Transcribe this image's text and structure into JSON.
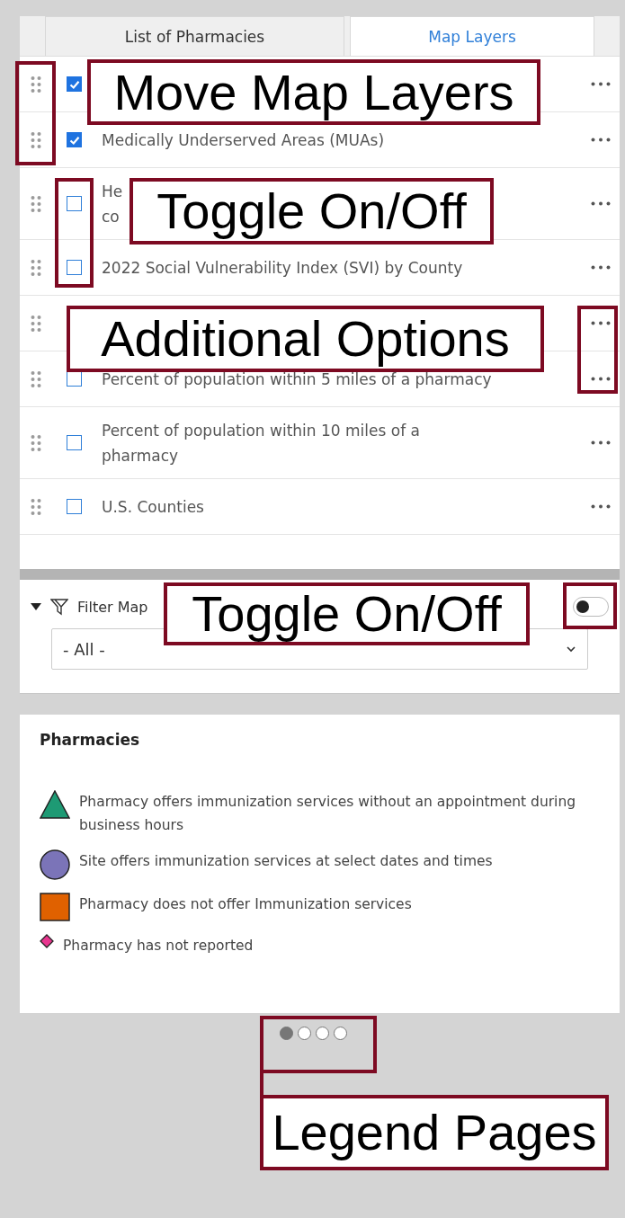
{
  "tabs": [
    {
      "label": "List of Pharmacies",
      "selected": false
    },
    {
      "label": "Map Layers",
      "selected": true
    }
  ],
  "layers": [
    {
      "kind": "layer",
      "checked": true
    },
    {
      "kind": "layer",
      "checked": true,
      "label_lines": [
        "Medically Underserved Areas (MUAs)"
      ]
    },
    {
      "kind": "layer",
      "checked": false,
      "label_lines": [
        "He",
        "co"
      ]
    },
    {
      "kind": "layer",
      "checked": false,
      "label_lines": [
        "2022 Social Vulnerability Index (SVI) by County"
      ]
    },
    {
      "kind": "covered"
    },
    {
      "kind": "layer",
      "checked": false,
      "label_lines": [
        "Percent of population within 5 miles of a pharmacy"
      ]
    },
    {
      "kind": "layer",
      "checked": false,
      "label_lines": [
        "Percent of population within 10 miles of a",
        "pharmacy"
      ]
    },
    {
      "kind": "layer",
      "checked": false,
      "label_lines": [
        "U.S. Counties"
      ]
    }
  ],
  "filter": {
    "label": "Filter Map",
    "expanded": true,
    "on": false,
    "select_value": "- All -"
  },
  "legend": {
    "title": "Pharmacies",
    "items": [
      {
        "kind": "triangle",
        "color": "#1e9a74",
        "label": "Pharmacy offers immunization services without an appointment during business hours"
      },
      {
        "kind": "circle",
        "color": "#7b74b8",
        "label": "Site offers immunization services at select dates and times"
      },
      {
        "kind": "square",
        "color": "#e06100",
        "label": "Pharmacy does not offer Immunization services"
      },
      {
        "kind": "diamond",
        "color": "#e8368f",
        "label": "Pharmacy has not reported"
      }
    ]
  },
  "pages": [
    {
      "selected": true
    },
    {
      "selected": false
    },
    {
      "selected": false
    },
    {
      "selected": false
    }
  ],
  "annotations": [
    "Move Map Layers",
    "Toggle On/Off",
    "Additional Options",
    "Toggle On/Off",
    "Legend Pages"
  ]
}
